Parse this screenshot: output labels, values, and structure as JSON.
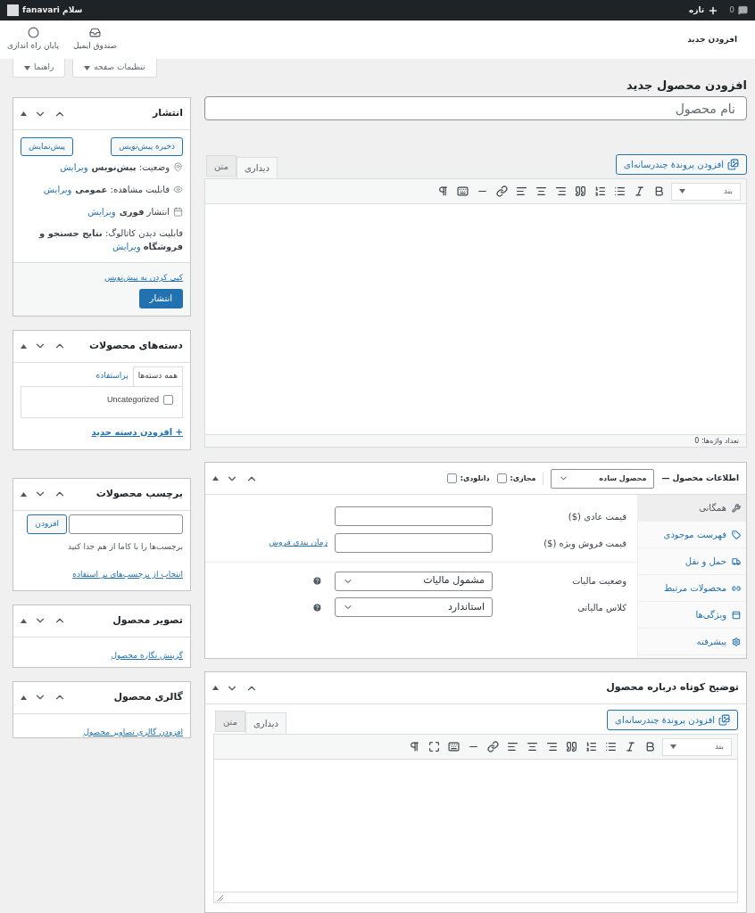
{
  "admin_bar": {
    "comments_count": "0",
    "new_label": "تازه",
    "greeting": "سلام fanavari"
  },
  "header": {
    "title": "افزودن جدید",
    "actions": [
      {
        "label": "صندوق ایمیل"
      },
      {
        "label": "پایان راه اندازی"
      }
    ]
  },
  "screen_buttons": [
    {
      "label": "تنظیمات صفحه"
    },
    {
      "label": "راهنما"
    }
  ],
  "page_title": "افزودن محصول جدید",
  "product_name": {
    "placeholder": "نام محصول"
  },
  "editor": {
    "media_button": "افزودن پروندهٔ چندرسانه‌ای",
    "tabs": [
      {
        "label": "دیداری",
        "selected": true
      },
      {
        "label": "متن",
        "selected": false
      }
    ],
    "format": "بند",
    "word_count": "تعداد واژه‌ها: 0"
  },
  "product_data": {
    "title": "اطلاعات محصول —",
    "type": "محصول ساده",
    "options": [
      {
        "label": "مجازی:",
        "checked": false
      },
      {
        "label": "دانلودی:",
        "checked": false
      }
    ],
    "tabs": [
      {
        "label": "همگانی",
        "selected": true
      },
      {
        "label": "فهرست موجودی",
        "selected": false
      },
      {
        "label": "حمل و نقل",
        "selected": false
      },
      {
        "label": "محصولات مرتبط",
        "selected": false
      },
      {
        "label": "ویژگی‌ها",
        "selected": false
      },
      {
        "label": "پیشرفته",
        "selected": false
      }
    ],
    "fields": [
      {
        "kind": "input",
        "label": "قیمت عادی ($)"
      },
      {
        "kind": "input",
        "label": "قیمت فروش ویژه ($)",
        "link": "زمان بندی فروش"
      },
      {
        "kind": "select",
        "label": "وضعیت مالیات",
        "value": "مشمول مالیات"
      },
      {
        "kind": "select",
        "label": "کلاس مالیاتی",
        "value": "استاندارد"
      }
    ]
  },
  "short_description": {
    "title": "توضیح کوتاه درباره محصول",
    "media_button": "افزودن پروندهٔ چندرسانه‌ای",
    "tabs": [
      {
        "label": "دیداری",
        "selected": true
      },
      {
        "label": "متن",
        "selected": false
      }
    ],
    "format": "بند"
  },
  "publish": {
    "title": "انتشار",
    "save_draft": "ذخیره پیش‌نویس",
    "preview": "پیش‌نمایش",
    "rows": [
      {
        "text": "وضعیت: **پیش‌نویس**",
        "link": "ویرایش"
      },
      {
        "text": "قابلیت مشاهده: **عمومی**",
        "link": "ویرایش"
      },
      {
        "text": "انتشار **فوری**",
        "link": "ویرایش"
      }
    ],
    "catalog": {
      "text": "قابلیت دیدن کاتالوگ: **نتایج جستجو و فروشگاه**",
      "link": "ویرایش"
    },
    "trash_link": "کپی کردن به پیش‌نویس",
    "publish_button": "انتشار"
  },
  "categories": {
    "title": "دسته‌های محصولات",
    "tabs": [
      {
        "label": "همه دسته‌ها",
        "selected": true
      },
      {
        "label": "پراستفاده",
        "selected": false
      }
    ],
    "items": [
      {
        "label": "Uncategorized",
        "checked": false
      }
    ],
    "add_link": "+ افزودن دسته جدید"
  },
  "tags": {
    "title": "برچسب محصولات",
    "add_button": "افزودن",
    "hint": "برچسب‌ها را با کاما از هم جدا کنید",
    "choose_link": "انتخاب از برچسب‌های پر استفاده"
  },
  "product_image": {
    "title": "تصویر محصول",
    "link": "گزینش نگاره محصول"
  },
  "gallery": {
    "title": "گالری محصول",
    "link": "افزودن گالری تصاویر محصول"
  }
}
